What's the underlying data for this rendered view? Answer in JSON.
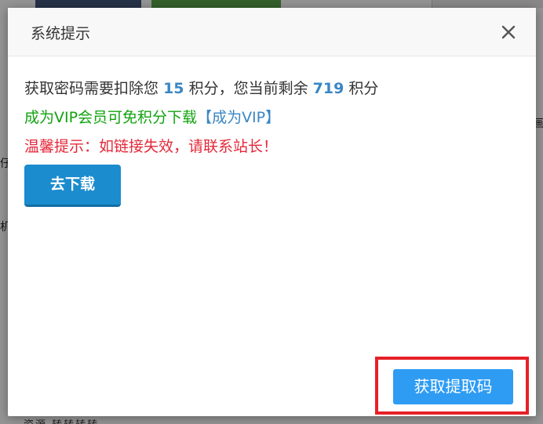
{
  "background": {
    "left_glyph_1": "仔",
    "left_glyph_2": "机",
    "right_glyph": "画",
    "bottom_text": "资源 转转转转"
  },
  "dialog": {
    "title": "系统提示",
    "close_icon": "close-icon",
    "line1": {
      "prefix": "获取密码需要扣除您",
      "cost": "15",
      "middle": "积分，您当前剩余",
      "balance": "719",
      "suffix": "积分"
    },
    "line2": {
      "text": "成为VIP会员可免积分下载",
      "link": "【成为VIP】"
    },
    "line3": "温馨提示：如链接失效，请联系站长！",
    "download_button": "去下载",
    "get_code_button": "获取提取码"
  },
  "colors": {
    "accent_blue": "#1b8ccd",
    "number_blue": "#3a86c4",
    "green_text": "#11a30f",
    "warning_red": "#e4293a",
    "highlight_red": "#e52127",
    "get_code_button": "#2e9cf3"
  }
}
